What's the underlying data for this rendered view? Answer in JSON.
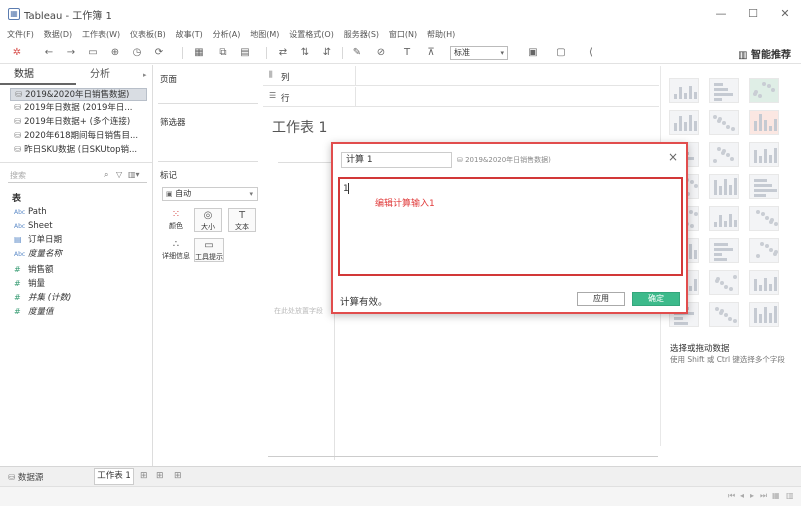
{
  "window": {
    "title": "Tableau - 工作簿 1",
    "minimize": "—",
    "maximize": "☐",
    "close": "✕"
  },
  "menu": [
    "文件(F)",
    "数据(D)",
    "工作表(W)",
    "仪表板(B)",
    "故事(T)",
    "分析(A)",
    "地图(M)",
    "设置格式(O)",
    "服务器(S)",
    "窗口(N)",
    "帮助(H)"
  ],
  "toolbar": {
    "fit_select": "标准",
    "smart_recommend": "智能推荐"
  },
  "data_pane": {
    "tab_data": "数据",
    "tab_analysis": "分析",
    "datasources": [
      "2019&2020年日销售数据)",
      "2019年日数据 (2019年日...",
      "2019年日数据+ (多个连接)",
      "2020年618期间每日销售目...",
      "昨日SKU数据 (日SKUtop销..."
    ],
    "search_placeholder": "搜索",
    "tables_header": "表",
    "fields": [
      {
        "type": "Abc",
        "name": "Path",
        "italic": false
      },
      {
        "type": "Abc",
        "name": "Sheet",
        "italic": false
      },
      {
        "type": "date",
        "name": "订单日期",
        "italic": false
      },
      {
        "type": "Abc",
        "name": "度量名称",
        "italic": true
      },
      {
        "type": "#",
        "name": "销售额",
        "italic": false
      },
      {
        "type": "#",
        "name": "销量",
        "italic": false
      },
      {
        "type": "#",
        "name": "并集 (计数)",
        "italic": true
      },
      {
        "type": "#",
        "name": "度量值",
        "italic": true
      }
    ]
  },
  "cards": {
    "pages": "页面",
    "filters": "筛选器",
    "marks": "标记",
    "marks_type": "自动",
    "mark_buttons": [
      "颜色",
      "大小",
      "文本",
      "详细信息",
      "工具提示"
    ]
  },
  "shelves": {
    "columns": "列",
    "rows": "行"
  },
  "worksheet": {
    "title": "工作表 1",
    "hint": "在此处放置字段"
  },
  "show_me": {
    "title": "选择或拖动数据",
    "desc": "使用 Shift 或 Ctrl 键选择多个字段"
  },
  "bottom": {
    "datasource_tab": "数据源",
    "sheet_tab": "工作表 1"
  },
  "dialog": {
    "calc_name": "计算 1",
    "datasource": "2019&2020年日销售数据)",
    "editor_text": "1",
    "annotation": "编辑计算输入1",
    "status": "计算有效。",
    "apply": "应用",
    "ok": "确定",
    "close": "×"
  }
}
